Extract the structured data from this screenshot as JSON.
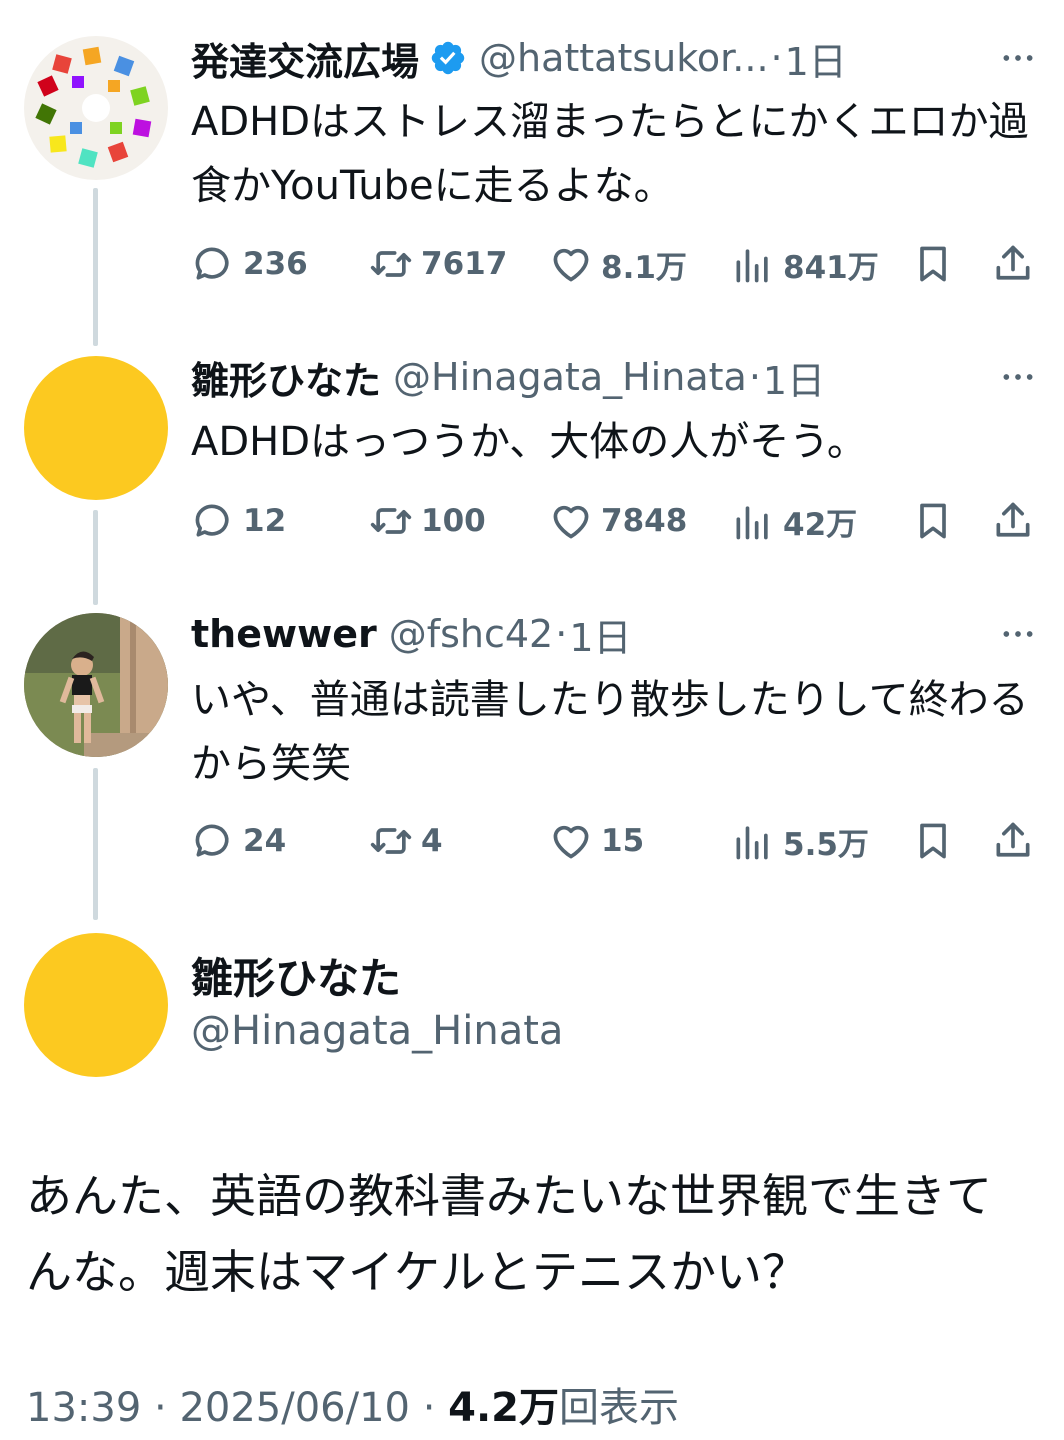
{
  "tweets": [
    {
      "name": "発達交流広場",
      "handle": "@hattatsukor...",
      "time": "1日",
      "text": "ADHDはストレス溜まったらとにかくエロか過食かYouTubeに走るよな。",
      "replies": "236",
      "retweets": "7617",
      "likes": "8.1万",
      "views": "841万"
    },
    {
      "name": "雛形ひなた",
      "handle": "@Hinagata_Hinata",
      "time": "1日",
      "text": "ADHDはっつうか、大体の人がそう。",
      "replies": "12",
      "retweets": "100",
      "likes": "7848",
      "views": "42万"
    },
    {
      "name": "thewwer",
      "handle": "@fshc42",
      "time": "1日",
      "text": "いや、普通は読書したり散歩したりして終わるから笑笑",
      "replies": "24",
      "retweets": "4",
      "likes": "15",
      "views": "5.5万"
    }
  ],
  "main": {
    "name": "雛形ひなた",
    "handle": "@Hinagata_Hinata",
    "text": "あんた、英語の教科書みたいな世界観で生きてんな。週末はマイケルとテニスかい？",
    "time": "13:39",
    "date": "2025/06/10",
    "views_count": "4.2万",
    "views_label": "回表示"
  },
  "separator": "·",
  "colors": {
    "text": "#0f1419",
    "muted": "#536471",
    "verified": "#1d9bf0",
    "avatar_yellow": "#fcc920",
    "thread_line": "#cfd9de"
  },
  "icons": [
    "reply-icon",
    "retweet-icon",
    "like-icon",
    "views-icon",
    "bookmark-icon",
    "share-icon",
    "more-icon",
    "verified-badge-icon"
  ]
}
